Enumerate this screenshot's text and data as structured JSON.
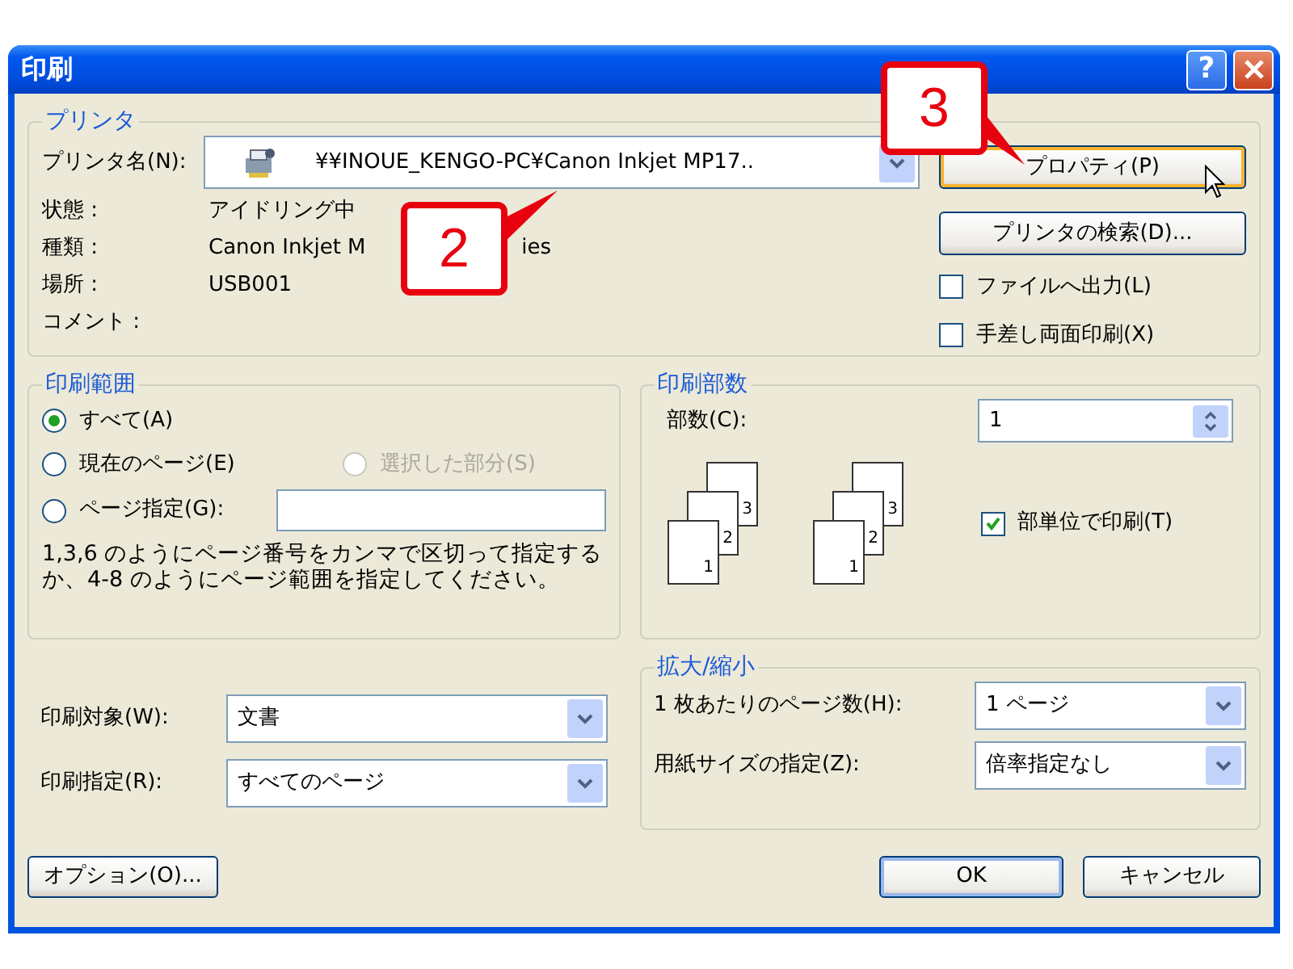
{
  "window": {
    "title": "印刷",
    "help": "?"
  },
  "printer": {
    "legend": "プリンタ",
    "name_label": "プリンタ名(N):",
    "name_value": "¥¥INOUE_KENGO-PC¥Canon Inkjet MP17..",
    "info": [
      {
        "label": "状態 :",
        "value_parts": [
          "アイドリング中"
        ]
      },
      {
        "label": "種類 :",
        "value_parts": [
          "Canon Inkjet M",
          "ies"
        ]
      },
      {
        "label": "場所 :",
        "value_parts": [
          "USB001"
        ]
      },
      {
        "label": "コメント :"
      }
    ],
    "buttons": [
      {
        "label": "プロパティ(P)",
        "hot": true
      },
      {
        "label": "プリンタの検索(D)...",
        "hot": false
      }
    ],
    "options": [
      {
        "label": "ファイルへ出力(L)",
        "checked": false
      },
      {
        "label": "手差し両面印刷(X)",
        "checked": false
      }
    ]
  },
  "page_range": {
    "legend": "印刷範囲",
    "options": [
      {
        "label": "すべて(A)",
        "selected": true,
        "disabled": false
      },
      {
        "label": "現在のページ(E)",
        "selected": false,
        "disabled": false
      },
      {
        "label": "選択した部分(S)",
        "selected": false,
        "disabled": true
      },
      {
        "label": "ページ指定(G):",
        "selected": false,
        "disabled": false
      }
    ],
    "hint": "1,3,6 のようにページ番号をカンマで区切って指定するか、4-8 のようにページ範囲を指定してください。"
  },
  "copies": {
    "legend": "印刷部数",
    "count_label": "部数(C):",
    "count_value": "1",
    "stacks": [
      {
        "pages": [
          "3",
          "2",
          "1"
        ]
      },
      {
        "pages": [
          "3",
          "2",
          "1"
        ]
      }
    ],
    "collate": {
      "label": "部単位で印刷(T)",
      "checked": true
    }
  },
  "print_fields": [
    {
      "label": "印刷対象(W):",
      "value": "文書"
    },
    {
      "label": "印刷指定(R):",
      "value": "すべてのページ"
    }
  ],
  "zoom": {
    "legend": "拡大/縮小",
    "rows": [
      {
        "label": "1 枚あたりのページ数(H):",
        "value": "1 ページ"
      },
      {
        "label": "用紙サイズの指定(Z):",
        "value": "倍率指定なし"
      }
    ]
  },
  "footer_buttons": [
    {
      "label": "オプション(O)...",
      "default": false
    },
    {
      "label": "OK",
      "default": true
    },
    {
      "label": "キャンセル",
      "default": false
    }
  ],
  "callouts": [
    {
      "number": "3"
    },
    {
      "number": "2"
    }
  ]
}
